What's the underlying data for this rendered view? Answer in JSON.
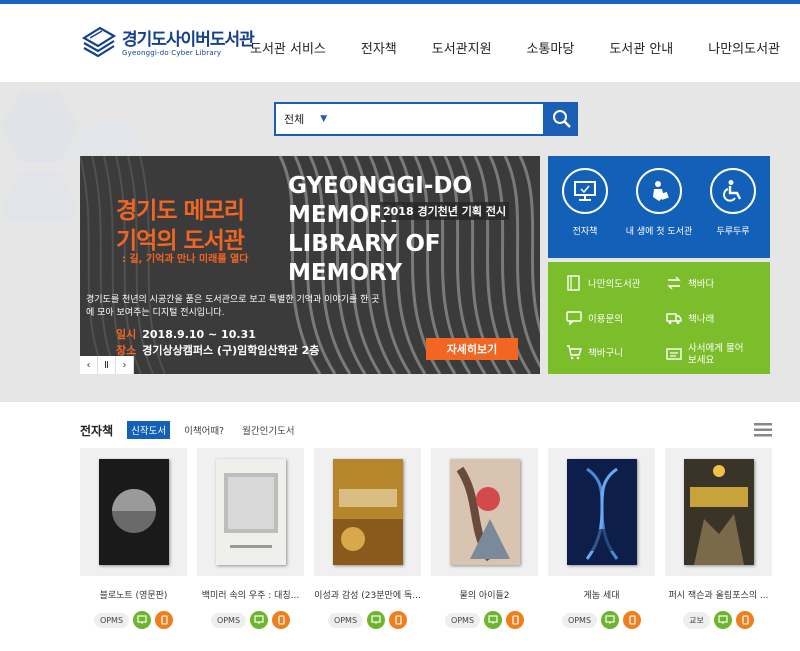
{
  "header": {
    "logo_main": "경기도사이버도서관",
    "logo_sub": "Gyeonggi-do Cyber Library",
    "nav": [
      "도서관 서비스",
      "전자책",
      "도서관지원",
      "소통마당",
      "도서관 안내",
      "나만의도서관"
    ]
  },
  "search": {
    "scope": "전체",
    "placeholder": ""
  },
  "banner": {
    "title_ko_1": "경기도 메모리",
    "title_ko_2": "기억의 도서관",
    "subtitle": ": 길, 기억과 만나 미래를 열다",
    "title_en_1": "GYEONGGI-DO",
    "title_en_2": "MEMORY",
    "title_en_3": "LIBRARY OF",
    "title_en_4": "MEMORY",
    "tag": "2018 경기천년 기획 전시",
    "desc": "경기도를 천년의 시공간을 품은 도서관으로 보고 특별한 기억과 이야기를 한 곳에 모아 보여주는 디지털 전시입니다.",
    "date_label": "일시",
    "date": "2018.9.10 ~ 10.31",
    "place_label": "장소",
    "place": "경기상상캠퍼스 (구)임학임산학관 2층",
    "button": "자세히보기",
    "ctrl_prev": "‹",
    "ctrl_pause": "Ⅱ",
    "ctrl_next": "›"
  },
  "quick_blue": [
    {
      "label": "전자책",
      "icon": "monitor-icon"
    },
    {
      "label": "내 생에 첫 도서관",
      "icon": "child-reading-icon"
    },
    {
      "label": "두루두루",
      "icon": "wheelchair-icon"
    }
  ],
  "quick_green": [
    {
      "label": "나만의도서관",
      "icon": "book-icon"
    },
    {
      "label": "책바다",
      "icon": "exchange-icon"
    },
    {
      "label": "이용문의",
      "icon": "chat-icon"
    },
    {
      "label": "책나래",
      "icon": "truck-icon"
    },
    {
      "label": "책바구니",
      "icon": "cart-icon"
    },
    {
      "label": "사서에게 물어보세요",
      "icon": "question-icon"
    }
  ],
  "ebook_section": {
    "title": "전자책",
    "tabs": [
      "신작도서",
      "이책어때?",
      "월간인기도서"
    ],
    "active_tab": "신작도서"
  },
  "books": [
    {
      "title": "블로노트 (영문판)",
      "format": "OPMS",
      "cover_color": "#1a1a1a"
    },
    {
      "title": "백미러 속의 우주 : 대칭...",
      "format": "OPMS",
      "cover_color": "#e9e9e6"
    },
    {
      "title": "이성과 감성 (23분만에 독...",
      "format": "OPMS",
      "cover_color": "#b6862c"
    },
    {
      "title": "물의 아이들2",
      "format": "OPMS",
      "cover_color": "#c9a68a"
    },
    {
      "title": "게놈 세대",
      "format": "OPMS",
      "cover_color": "#0e1e4a"
    },
    {
      "title": "퍼시 잭슨과 올림포스의 ...",
      "format": "교보",
      "cover_color": "#3a3428"
    }
  ],
  "colors": {
    "primary_blue": "#1360b8",
    "green": "#7bbd2a",
    "orange": "#f26522"
  }
}
